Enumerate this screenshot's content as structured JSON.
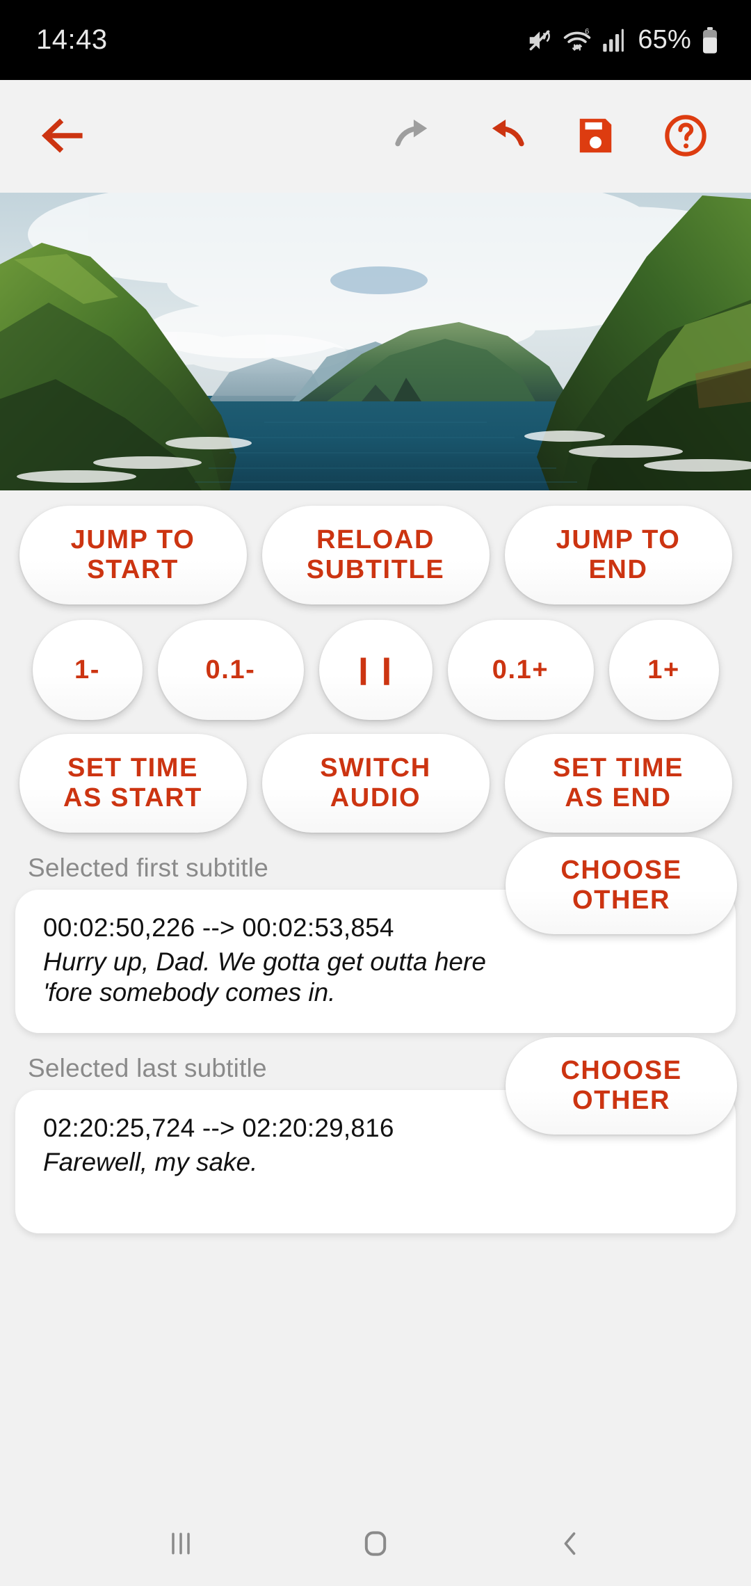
{
  "status_bar": {
    "clock": "14:43",
    "battery_percent": "65%",
    "icons": [
      "mute-icon",
      "wifi-6-icon",
      "cellular-signal-icon",
      "battery-icon"
    ]
  },
  "toolbar": {
    "back_label": "back-arrow",
    "redo_label": "redo",
    "undo_label": "undo",
    "save_label": "save",
    "help_label": "help",
    "accent_color": "#cc3411",
    "disabled_color": "#9e9e9e"
  },
  "video": {
    "description": "Aerial view of green sea cliffs over blue ocean"
  },
  "controls": {
    "row1": [
      {
        "label_line1": "JUMP TO",
        "label_line2": "START"
      },
      {
        "label_line1": "RELOAD",
        "label_line2": "SUBTITLE"
      },
      {
        "label_line1": "JUMP TO",
        "label_line2": "END"
      }
    ],
    "row2": [
      {
        "label": "1-"
      },
      {
        "label": "0.1-"
      },
      {
        "label": "❙❙"
      },
      {
        "label": "0.1+"
      },
      {
        "label": "1+"
      }
    ],
    "row3": [
      {
        "label_line1": "SET TIME",
        "label_line2": "AS START"
      },
      {
        "label_line1": "SWITCH",
        "label_line2": "AUDIO"
      },
      {
        "label_line1": "SET TIME",
        "label_line2": "AS END"
      }
    ]
  },
  "first_subtitle": {
    "section_label": "Selected first subtitle",
    "choose_line1": "CHOOSE",
    "choose_line2": "OTHER",
    "timing": "00:02:50,226 --> 00:02:53,854",
    "text": "Hurry up, Dad. We gotta get outta here 'fore somebody comes in."
  },
  "last_subtitle": {
    "section_label": "Selected last subtitle",
    "choose_line1": "CHOOSE",
    "choose_line2": "OTHER",
    "timing": "02:20:25,724 --> 02:20:29,816",
    "text": "Farewell, my sake."
  },
  "navbar": {
    "recents_label": "recents",
    "home_label": "home",
    "back_label": "back"
  }
}
